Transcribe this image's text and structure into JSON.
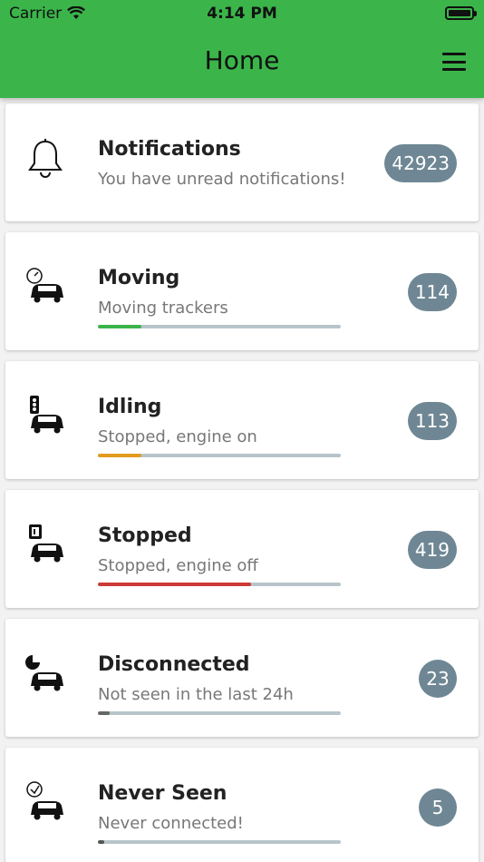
{
  "status_bar": {
    "carrier": "Carrier",
    "time": "4:14 PM"
  },
  "header": {
    "title": "Home"
  },
  "colors": {
    "header_bg": "#3bb54a",
    "badge_bg": "#6f8794",
    "track_bg": "#b7c5ca"
  },
  "cards": [
    {
      "icon": "bell-icon",
      "title": "Notifications",
      "subtitle": "You have unread notifications!",
      "count": "42923"
    },
    {
      "icon": "moving-car-icon",
      "title": "Moving",
      "subtitle": "Moving trackers",
      "count": "114",
      "progress": 0.18,
      "color": "#3bb54a"
    },
    {
      "icon": "traffic-light-car-icon",
      "title": "Idling",
      "subtitle": "Stopped, engine on",
      "count": "113",
      "progress": 0.18,
      "color": "#e39b1f"
    },
    {
      "icon": "parking-car-icon",
      "title": "Stopped",
      "subtitle": "Stopped, engine off",
      "count": "419",
      "progress": 0.63,
      "color": "#cc3b35"
    },
    {
      "icon": "disconnected-car-icon",
      "title": "Disconnected",
      "subtitle": "Not seen in the last 24h",
      "count": "23",
      "progress": 0.05,
      "color": "#666666"
    },
    {
      "icon": "never-seen-car-icon",
      "title": "Never Seen",
      "subtitle": "Never connected!",
      "count": "5",
      "progress": 0.025,
      "color": "#555555"
    }
  ]
}
